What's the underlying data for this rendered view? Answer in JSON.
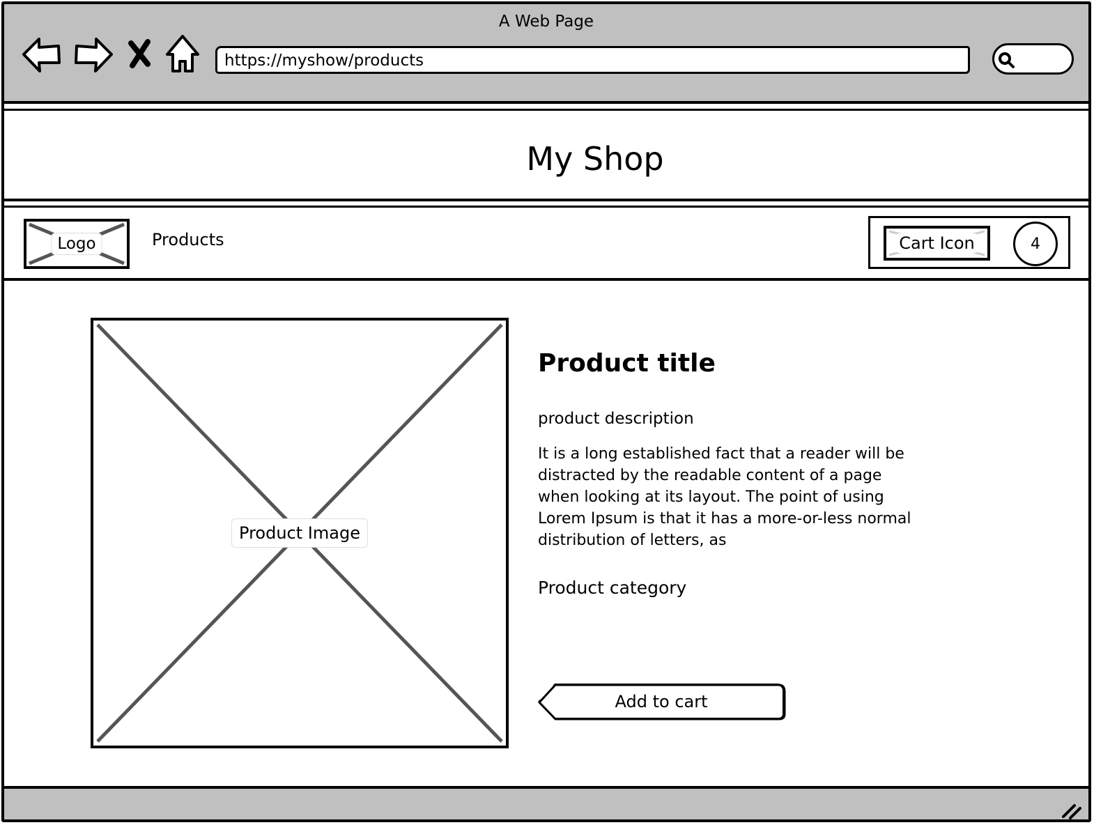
{
  "browser": {
    "window_title": "A Web Page",
    "url": "https://myshow/products",
    "icons": [
      "back-arrow-icon",
      "forward-arrow-icon",
      "stop-icon",
      "home-icon",
      "search-icon"
    ]
  },
  "header": {
    "title": "My Shop"
  },
  "navbar": {
    "logo_label": "Logo",
    "links": [
      {
        "label": "Products"
      }
    ],
    "cart_icon_label": "Cart Icon",
    "cart_count": "4"
  },
  "product": {
    "image_label": "Product Image",
    "title": "Product title",
    "description_label": "product description",
    "description_text": "It is a long established fact that a reader will be distracted by the readable content of a page when looking at its layout. The point of using Lorem Ipsum is that it has a more-or-less normal distribution of letters, as",
    "category": "Product category",
    "add_to_cart_label": "Add to cart"
  },
  "colors": {
    "chrome": "#c0c0c0",
    "border": "#000000",
    "placeholder_cross": "#555555"
  }
}
